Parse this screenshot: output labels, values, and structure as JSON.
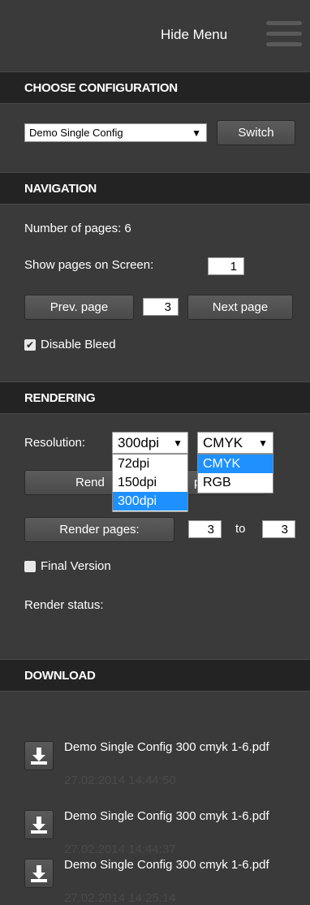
{
  "header": {
    "hide_menu_label": "Hide Menu"
  },
  "configuration": {
    "title": "CHOOSE CONFIGURATION",
    "selected": "Demo Single Config",
    "switch_label": "Switch"
  },
  "navigation": {
    "title": "NAVIGATION",
    "pages_count_text": "Number of pages: 6",
    "show_pages_label": "Show pages on Screen:",
    "show_pages_value": "1",
    "prev_label": "Prev. page",
    "current_page": "3",
    "next_label": "Next page",
    "disable_bleed_label": "Disable Bleed",
    "disable_bleed_checked": true
  },
  "rendering": {
    "title": "RENDERING",
    "resolution_label": "Resolution:",
    "resolution_selected": "300dpi",
    "resolution_options": [
      "72dpi",
      "150dpi",
      "300dpi"
    ],
    "color_selected": "CMYK",
    "color_options": [
      "CMYK",
      "RGB"
    ],
    "render_current_label_left": "Rend",
    "render_current_label_right": "pa",
    "render_pages_label": "Render pages:",
    "from_page": "3",
    "to_label": "to",
    "to_page": "3",
    "final_version_label": "Final Version",
    "render_status_label": "Render status:"
  },
  "download": {
    "title": "DOWNLOAD",
    "files": [
      {
        "name": "Demo Single Config 300 cmyk 1-6.pdf",
        "date": "27.02.2014 14:44:50"
      },
      {
        "name": "Demo Single Config 300 cmyk 1-6.pdf",
        "date": "27.02.2014 14:44:37"
      },
      {
        "name": "Demo Single Config 300 cmyk 1-6.pdf",
        "date": "27.02.2014 14:25:14"
      }
    ]
  },
  "colors": {
    "panel": "#3a3a3a",
    "header": "#232323",
    "selection": "#1e90ff"
  },
  "icons": {
    "menu": "hamburger-icon",
    "download": "download-icon",
    "checkbox": "checkbox-icon"
  }
}
